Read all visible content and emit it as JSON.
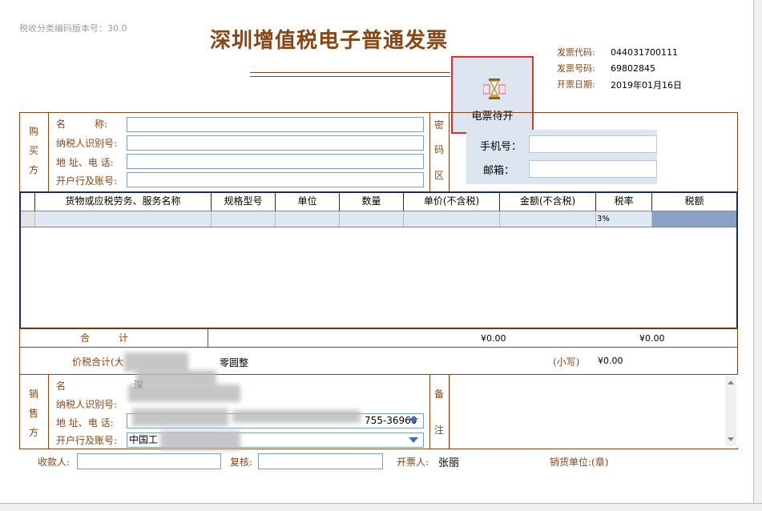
{
  "version_label": "税收分类编码版本号：30.0",
  "title": "深圳增值税电子普通发票",
  "invoice_meta": {
    "code_label": "发票代码:",
    "code_value": "044031700111",
    "number_label": "发票号码:",
    "number_value": "69802845",
    "date_label": "开票日期:",
    "date_value": "2019年01月16日"
  },
  "pending_button": {
    "label": "电票待开",
    "icon": "hourglass-icon"
  },
  "buyer": {
    "section_chars": [
      "购",
      "买",
      "方"
    ],
    "name_label": "名　　　称:",
    "taxid_label": "纳税人识别号:",
    "address_label": "地  址、电  话:",
    "bank_label": "开户行及账号:"
  },
  "password_area": {
    "section_chars": [
      "密",
      "码",
      "区"
    ],
    "phone_label": "手机号：",
    "email_label": "邮箱："
  },
  "goods_table": {
    "columns": [
      "货物或应税劳务、服务名称",
      "规格型号",
      "单位",
      "数量",
      "单价(不含税)",
      "金额(不含税)",
      "税率",
      "税额"
    ],
    "rows": [
      {
        "name": "",
        "spec": "",
        "unit": "",
        "qty": "",
        "price": "",
        "amount": "",
        "rate": "3%",
        "tax": ""
      }
    ]
  },
  "totals": {
    "total_label": "合　　　计",
    "amount_total": "¥0.00",
    "tax_total": "¥0.00",
    "price_tax_label": "价税合计(大",
    "amount_words": "零圆整",
    "small_label": "(小写)",
    "small_value": "¥0.00"
  },
  "seller": {
    "section_chars": [
      "销",
      "售",
      "方"
    ],
    "name_label": "名",
    "taxid_label": "纳税人识别号:",
    "address_label": "地  址、电  话:",
    "bank_label": "开户行及账号:",
    "name_value": "深",
    "address_value": "755-36960",
    "bank_value": "中国工"
  },
  "remarks": {
    "section_chars": [
      "备",
      "注"
    ]
  },
  "footer": {
    "payee_label": "收款人:",
    "reviewer_label": "复核:",
    "issuer_label": "开票人:",
    "issuer_value": "张丽",
    "seller_seal_label": "销货单位:(章)"
  },
  "colors": {
    "brown": "#8b4513",
    "red_highlight": "#e0302a",
    "grid_border": "#1b2f5e",
    "row_fill": "#dfe8f3",
    "tax_cell_fill": "#8aa1c4"
  }
}
